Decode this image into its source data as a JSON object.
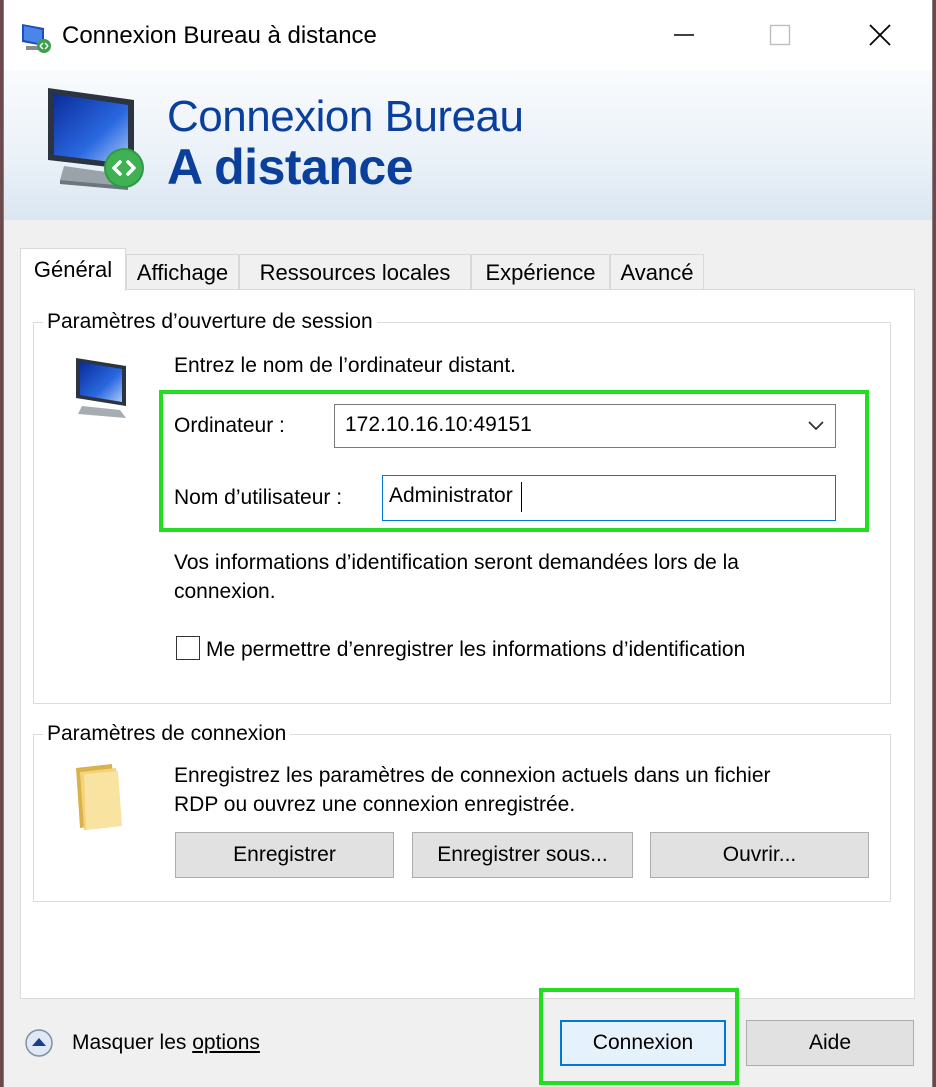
{
  "window": {
    "title": "Connexion Bureau à distance"
  },
  "banner": {
    "line1": "Connexion Bureau",
    "line2": "A distance"
  },
  "tabs": [
    {
      "label": "Général",
      "active": true
    },
    {
      "label": "Affichage",
      "active": false
    },
    {
      "label": "Ressources locales",
      "active": false
    },
    {
      "label": "Expérience",
      "active": false
    },
    {
      "label": "Avancé",
      "active": false
    }
  ],
  "session": {
    "legend": "Paramètres d’ouverture de session",
    "instruction": "Entrez le nom de l’ordinateur distant.",
    "computer_label": "Ordinateur :",
    "computer_value": "172.10.16.10:49151",
    "username_label": "Nom d’utilisateur :",
    "username_value": "Administrator",
    "info_line1": "Vos informations d’identification seront demandées lors de la",
    "info_line2": "connexion.",
    "save_credentials_label": "Me permettre d’enregistrer les informations d’identification",
    "save_credentials_checked": false
  },
  "connection": {
    "legend": "Paramètres de connexion",
    "desc_line1": "Enregistrez les paramètres de connexion actuels dans un fichier",
    "desc_line2": "RDP ou ouvrez une connexion enregistrée.",
    "save_label": "Enregistrer",
    "save_as_label": "Enregistrer sous...",
    "open_label": "Ouvrir..."
  },
  "footer": {
    "hide_options_prefix": "Masquer les ",
    "hide_options_underlined": "options",
    "connect_label": "Connexion",
    "help_label": "Aide"
  },
  "colors": {
    "banner_text": "#0a3f9c",
    "highlight": "#22dd22",
    "focus_border": "#0078d7"
  }
}
